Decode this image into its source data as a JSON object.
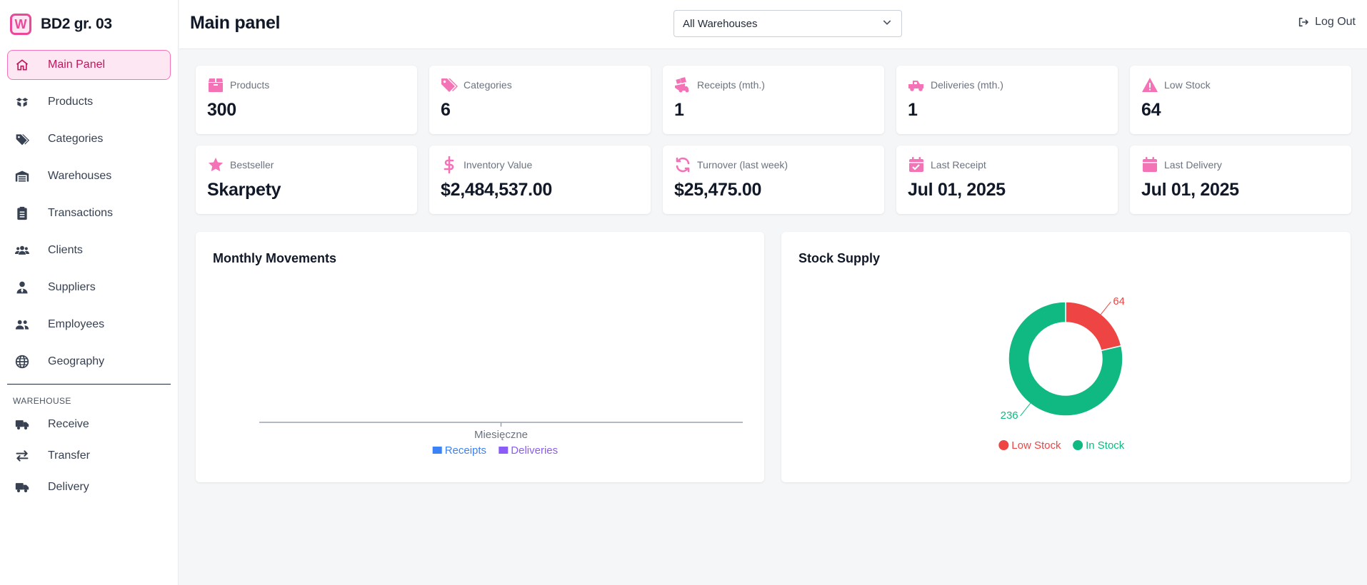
{
  "brand": {
    "logo_letter": "W",
    "name": "BD2 gr. 03"
  },
  "sidebar": {
    "items": [
      {
        "label": "Main Panel",
        "icon": "home-icon",
        "active": true
      },
      {
        "label": "Products",
        "icon": "boxes-icon"
      },
      {
        "label": "Categories",
        "icon": "tags-icon"
      },
      {
        "label": "Warehouses",
        "icon": "warehouse-icon"
      },
      {
        "label": "Transactions",
        "icon": "clipboard-icon"
      },
      {
        "label": "Clients",
        "icon": "users-icon"
      },
      {
        "label": "Suppliers",
        "icon": "user-tie-icon"
      },
      {
        "label": "Employees",
        "icon": "user-group-icon"
      },
      {
        "label": "Geography",
        "icon": "globe-icon"
      }
    ],
    "section_label": "WAREHOUSE",
    "warehouse_items": [
      {
        "label": "Receive",
        "icon": "truck-icon"
      },
      {
        "label": "Transfer",
        "icon": "arrows-exchange-icon"
      },
      {
        "label": "Delivery",
        "icon": "truck-fast-icon"
      }
    ]
  },
  "header": {
    "title": "Main panel",
    "warehouse_select": "All Warehouses",
    "logout_label": "Log Out"
  },
  "stats": [
    {
      "label": "Products",
      "value": "300",
      "icon": "box-icon"
    },
    {
      "label": "Categories",
      "value": "6",
      "icon": "tags-icon"
    },
    {
      "label": "Receipts (mth.)",
      "value": "1",
      "icon": "truck-ramp-icon"
    },
    {
      "label": "Deliveries (mth.)",
      "value": "1",
      "icon": "truck-pickup-icon"
    },
    {
      "label": "Low Stock",
      "value": "64",
      "icon": "warning-icon"
    },
    {
      "label": "Bestseller",
      "value": "Skarpety",
      "icon": "star-icon"
    },
    {
      "label": "Inventory Value",
      "value": "$2,484,537.00",
      "icon": "dollar-icon"
    },
    {
      "label": "Turnover (last week)",
      "value": "$25,475.00",
      "icon": "refresh-icon"
    },
    {
      "label": "Last Receipt",
      "value": "Jul 01, 2025",
      "icon": "calendar-check-icon"
    },
    {
      "label": "Last Delivery",
      "value": "Jul 01, 2025",
      "icon": "calendar-icon"
    }
  ],
  "colors": {
    "accent": "#ec4899",
    "receipts": "#3b82f6",
    "deliveries": "#8b5cf6",
    "low_stock": "#ef4444",
    "in_stock": "#10b981"
  },
  "chart_data": [
    {
      "type": "bar",
      "title": "Monthly Movements",
      "categories": [
        "Miesięczne"
      ],
      "series": [
        {
          "name": "Receipts",
          "values": [
            0
          ]
        },
        {
          "name": "Deliveries",
          "values": [
            0
          ]
        }
      ],
      "legend": "bottom"
    },
    {
      "type": "pie",
      "title": "Stock Supply",
      "donut": true,
      "labels": [
        "Low Stock",
        "In Stock"
      ],
      "values": [
        64,
        236
      ],
      "legend": "bottom"
    }
  ]
}
